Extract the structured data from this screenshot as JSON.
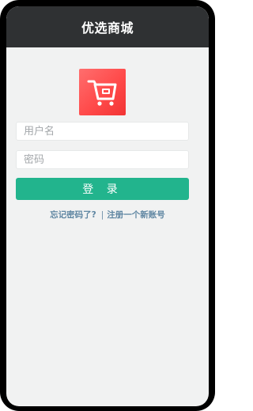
{
  "header": {
    "title": "优选商城"
  },
  "logo": {
    "icon": "shopping-cart-icon",
    "background_color": "#ff4a4a"
  },
  "form": {
    "username_placeholder": "用户名",
    "password_placeholder": "密码",
    "login_label": "登 录"
  },
  "links": {
    "forgot_password": "忘记密码了?",
    "separator": "|",
    "register": "注册一个新账号"
  },
  "colors": {
    "header_bg": "#2f3133",
    "page_bg": "#f1f2f2",
    "accent": "#22b48d",
    "link": "#5f86a2"
  }
}
